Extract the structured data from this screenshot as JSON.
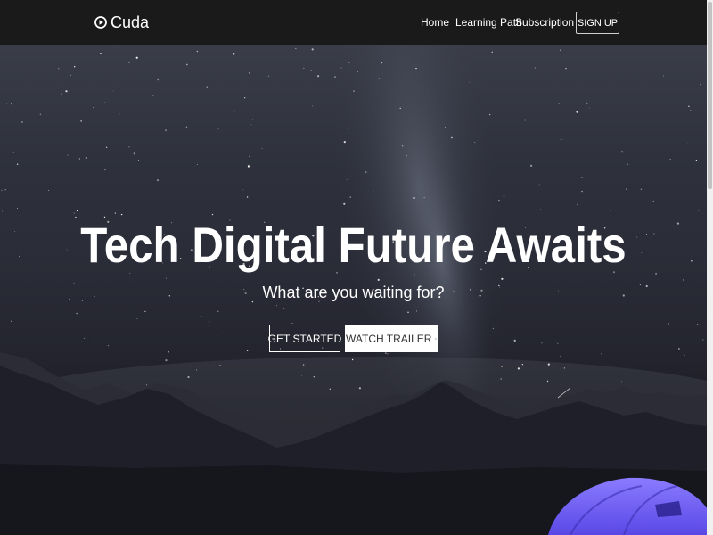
{
  "navbar": {
    "brand": {
      "name": "Cuda",
      "icon": "play-circle-icon"
    },
    "links": [
      {
        "label": "Home"
      },
      {
        "label": "Learning Path"
      },
      {
        "label": "Subscription"
      }
    ],
    "signup_label": "SIGN UP"
  },
  "hero": {
    "title": "Tech Digital Future Awaits",
    "subtitle": "What are you waiting for?",
    "primary_button": "GET STARTED",
    "secondary_button": {
      "label": "WATCH TRAILER",
      "icon": "play-circle-icon"
    },
    "background": "night-sky-milky-way-mountains-tent-photo"
  },
  "colors": {
    "navbar_bg": "#1b1a1a",
    "text": "#ffffff",
    "tent": "#6a5cf0"
  }
}
